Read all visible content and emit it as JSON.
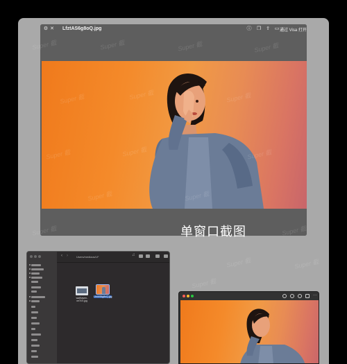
{
  "preview": {
    "title": "LfztAS6g8oQ.jpg",
    "open_label": "通过 Visa 打开",
    "icons": [
      "info-icon",
      "share-icon",
      "zoom-icon",
      "rotate-icon"
    ]
  },
  "caption": "单窗口截图",
  "finder": {
    "path": "Users/mediaos/LF",
    "files": [
      {
        "name": "wallhaven-xe7k7l.jpg",
        "selected": false
      },
      {
        "name": "LfztAS6g8oQ.jpg",
        "selected": true
      }
    ]
  },
  "watermark": "Super 截",
  "colors": {
    "accent": "#f07a1c",
    "finder_bg": "#2d2a2c",
    "selection": "#2a5db0"
  }
}
